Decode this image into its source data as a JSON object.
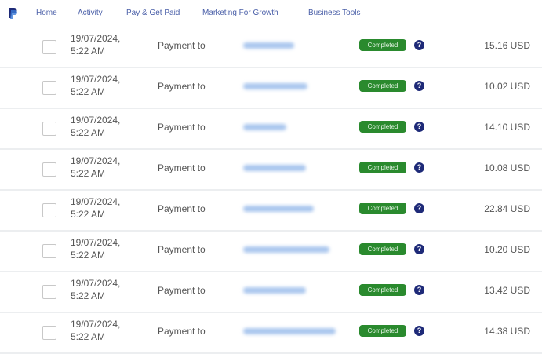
{
  "nav": {
    "items": [
      "Home",
      "Activity",
      "Pay & Get Paid",
      "Marketing For Growth",
      "Business Tools"
    ]
  },
  "colors": {
    "brand": "#1e2a78",
    "status_completed": "#2a8a2e",
    "link": "#4a5fa8"
  },
  "transactions": [
    {
      "date": "19/07/2024,",
      "time": "5:22 AM",
      "type": "Payment to",
      "status": "Completed",
      "amount": "15.16 USD"
    },
    {
      "date": "19/07/2024,",
      "time": "5:22 AM",
      "type": "Payment to",
      "status": "Completed",
      "amount": "10.02 USD"
    },
    {
      "date": "19/07/2024,",
      "time": "5:22 AM",
      "type": "Payment to",
      "status": "Completed",
      "amount": "14.10 USD"
    },
    {
      "date": "19/07/2024,",
      "time": "5:22 AM",
      "type": "Payment to",
      "status": "Completed",
      "amount": "10.08 USD"
    },
    {
      "date": "19/07/2024,",
      "time": "5:22 AM",
      "type": "Payment to",
      "status": "Completed",
      "amount": "22.84 USD"
    },
    {
      "date": "19/07/2024,",
      "time": "5:22 AM",
      "type": "Payment to",
      "status": "Completed",
      "amount": "10.20 USD"
    },
    {
      "date": "19/07/2024,",
      "time": "5:22 AM",
      "type": "Payment to",
      "status": "Completed",
      "amount": "13.42 USD"
    },
    {
      "date": "19/07/2024,",
      "time": "5:22 AM",
      "type": "Payment to",
      "status": "Completed",
      "amount": "14.38 USD"
    }
  ]
}
